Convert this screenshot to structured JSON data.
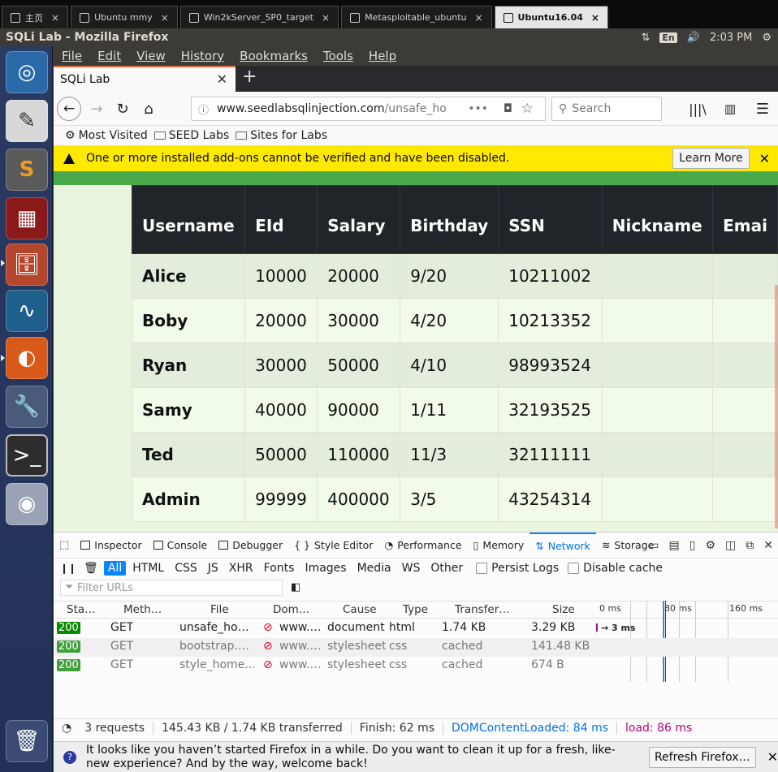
{
  "vm_tabs": [
    {
      "label": "主页",
      "icon": "home-icon"
    },
    {
      "label": "Ubuntu mmy",
      "icon": "vm-icon"
    },
    {
      "label": "Win2kServer_SP0_target",
      "icon": "vm-icon"
    },
    {
      "label": "Metasploitable_ubuntu",
      "icon": "vm-icon"
    },
    {
      "label": "Ubuntu16.04",
      "icon": "vm-icon",
      "active": true
    }
  ],
  "panel": {
    "window_title": "SQLi Lab - Mozilla Firefox",
    "keyboard": "En",
    "time": "2:03 PM"
  },
  "menus": [
    "File",
    "Edit",
    "View",
    "History",
    "Bookmarks",
    "Tools",
    "Help"
  ],
  "tab": {
    "title": "SQLi Lab"
  },
  "url": {
    "domain": "www.seedlabsqlinjection.com",
    "path": "/unsafe_ho"
  },
  "search": {
    "placeholder": "Search"
  },
  "bookmarks": [
    "Most Visited",
    "SEED Labs",
    "Sites for Labs"
  ],
  "notice": {
    "message": "One or more installed add-ons cannot be verified and have been disabled.",
    "button": "Learn More"
  },
  "table": {
    "headers": [
      "Username",
      "EId",
      "Salary",
      "Birthday",
      "SSN",
      "Nickname",
      "Emai"
    ],
    "rows": [
      [
        "Alice",
        "10000",
        "20000",
        "9/20",
        "10211002"
      ],
      [
        "Boby",
        "20000",
        "30000",
        "4/20",
        "10213352"
      ],
      [
        "Ryan",
        "30000",
        "50000",
        "4/10",
        "98993524"
      ],
      [
        "Samy",
        "40000",
        "90000",
        "1/11",
        "32193525"
      ],
      [
        "Ted",
        "50000",
        "110000",
        "11/3",
        "32111111"
      ],
      [
        "Admin",
        "99999",
        "400000",
        "3/5",
        "43254314"
      ]
    ]
  },
  "devtools": {
    "tabs": [
      "Inspector",
      "Console",
      "Debugger",
      "Style Editor",
      "Performance",
      "Memory",
      "Network",
      "Storage"
    ],
    "active_tab": "Network",
    "filters": [
      "All",
      "HTML",
      "CSS",
      "JS",
      "XHR",
      "Fonts",
      "Images",
      "Media",
      "WS",
      "Other"
    ],
    "persist_logs": "Persist Logs",
    "disable_cache": "Disable cache",
    "filter_placeholder": "Filter URLs",
    "columns": [
      "Sta…",
      "Meth…",
      "File",
      "Dom…",
      "Cause",
      "Type",
      "Transfer…",
      "Size"
    ],
    "timeline": [
      "0 ms",
      "80 ms",
      "160 ms"
    ],
    "requests": [
      {
        "status": "200",
        "method": "GET",
        "file": "unsafe_ho…",
        "domain": "www.…",
        "cause": "document",
        "type": "html",
        "transferred": "1.74 KB",
        "size": "3.29 KB",
        "timing": "→ 3 ms"
      },
      {
        "status": "200",
        "method": "GET",
        "file": "bootstrap.…",
        "domain": "www.…",
        "cause": "stylesheet",
        "type": "css",
        "transferred": "cached",
        "size": "141.48 KB",
        "timing": ""
      },
      {
        "status": "200",
        "method": "GET",
        "file": "style_home.…",
        "domain": "www.…",
        "cause": "stylesheet",
        "type": "css",
        "transferred": "cached",
        "size": "674 B",
        "timing": ""
      }
    ],
    "summary": {
      "requests": "3 requests",
      "transferred": "145.43 KB / 1.74 KB transferred",
      "finish": "Finish: 62 ms",
      "dcl": "DOMContentLoaded: 84 ms",
      "load": "load: 86 ms"
    }
  },
  "refresh": {
    "message": "It looks like you haven’t started Firefox in a while. Do you want to clean it up for a fresh, like-new experience? And by the way, welcome back!",
    "button": "Refresh Firefox…"
  },
  "colors": {
    "dcl": "#0074e8",
    "load": "#b5007f",
    "status_ok": "#058b00",
    "notice": "#ffe900",
    "table_head": "#212529"
  }
}
